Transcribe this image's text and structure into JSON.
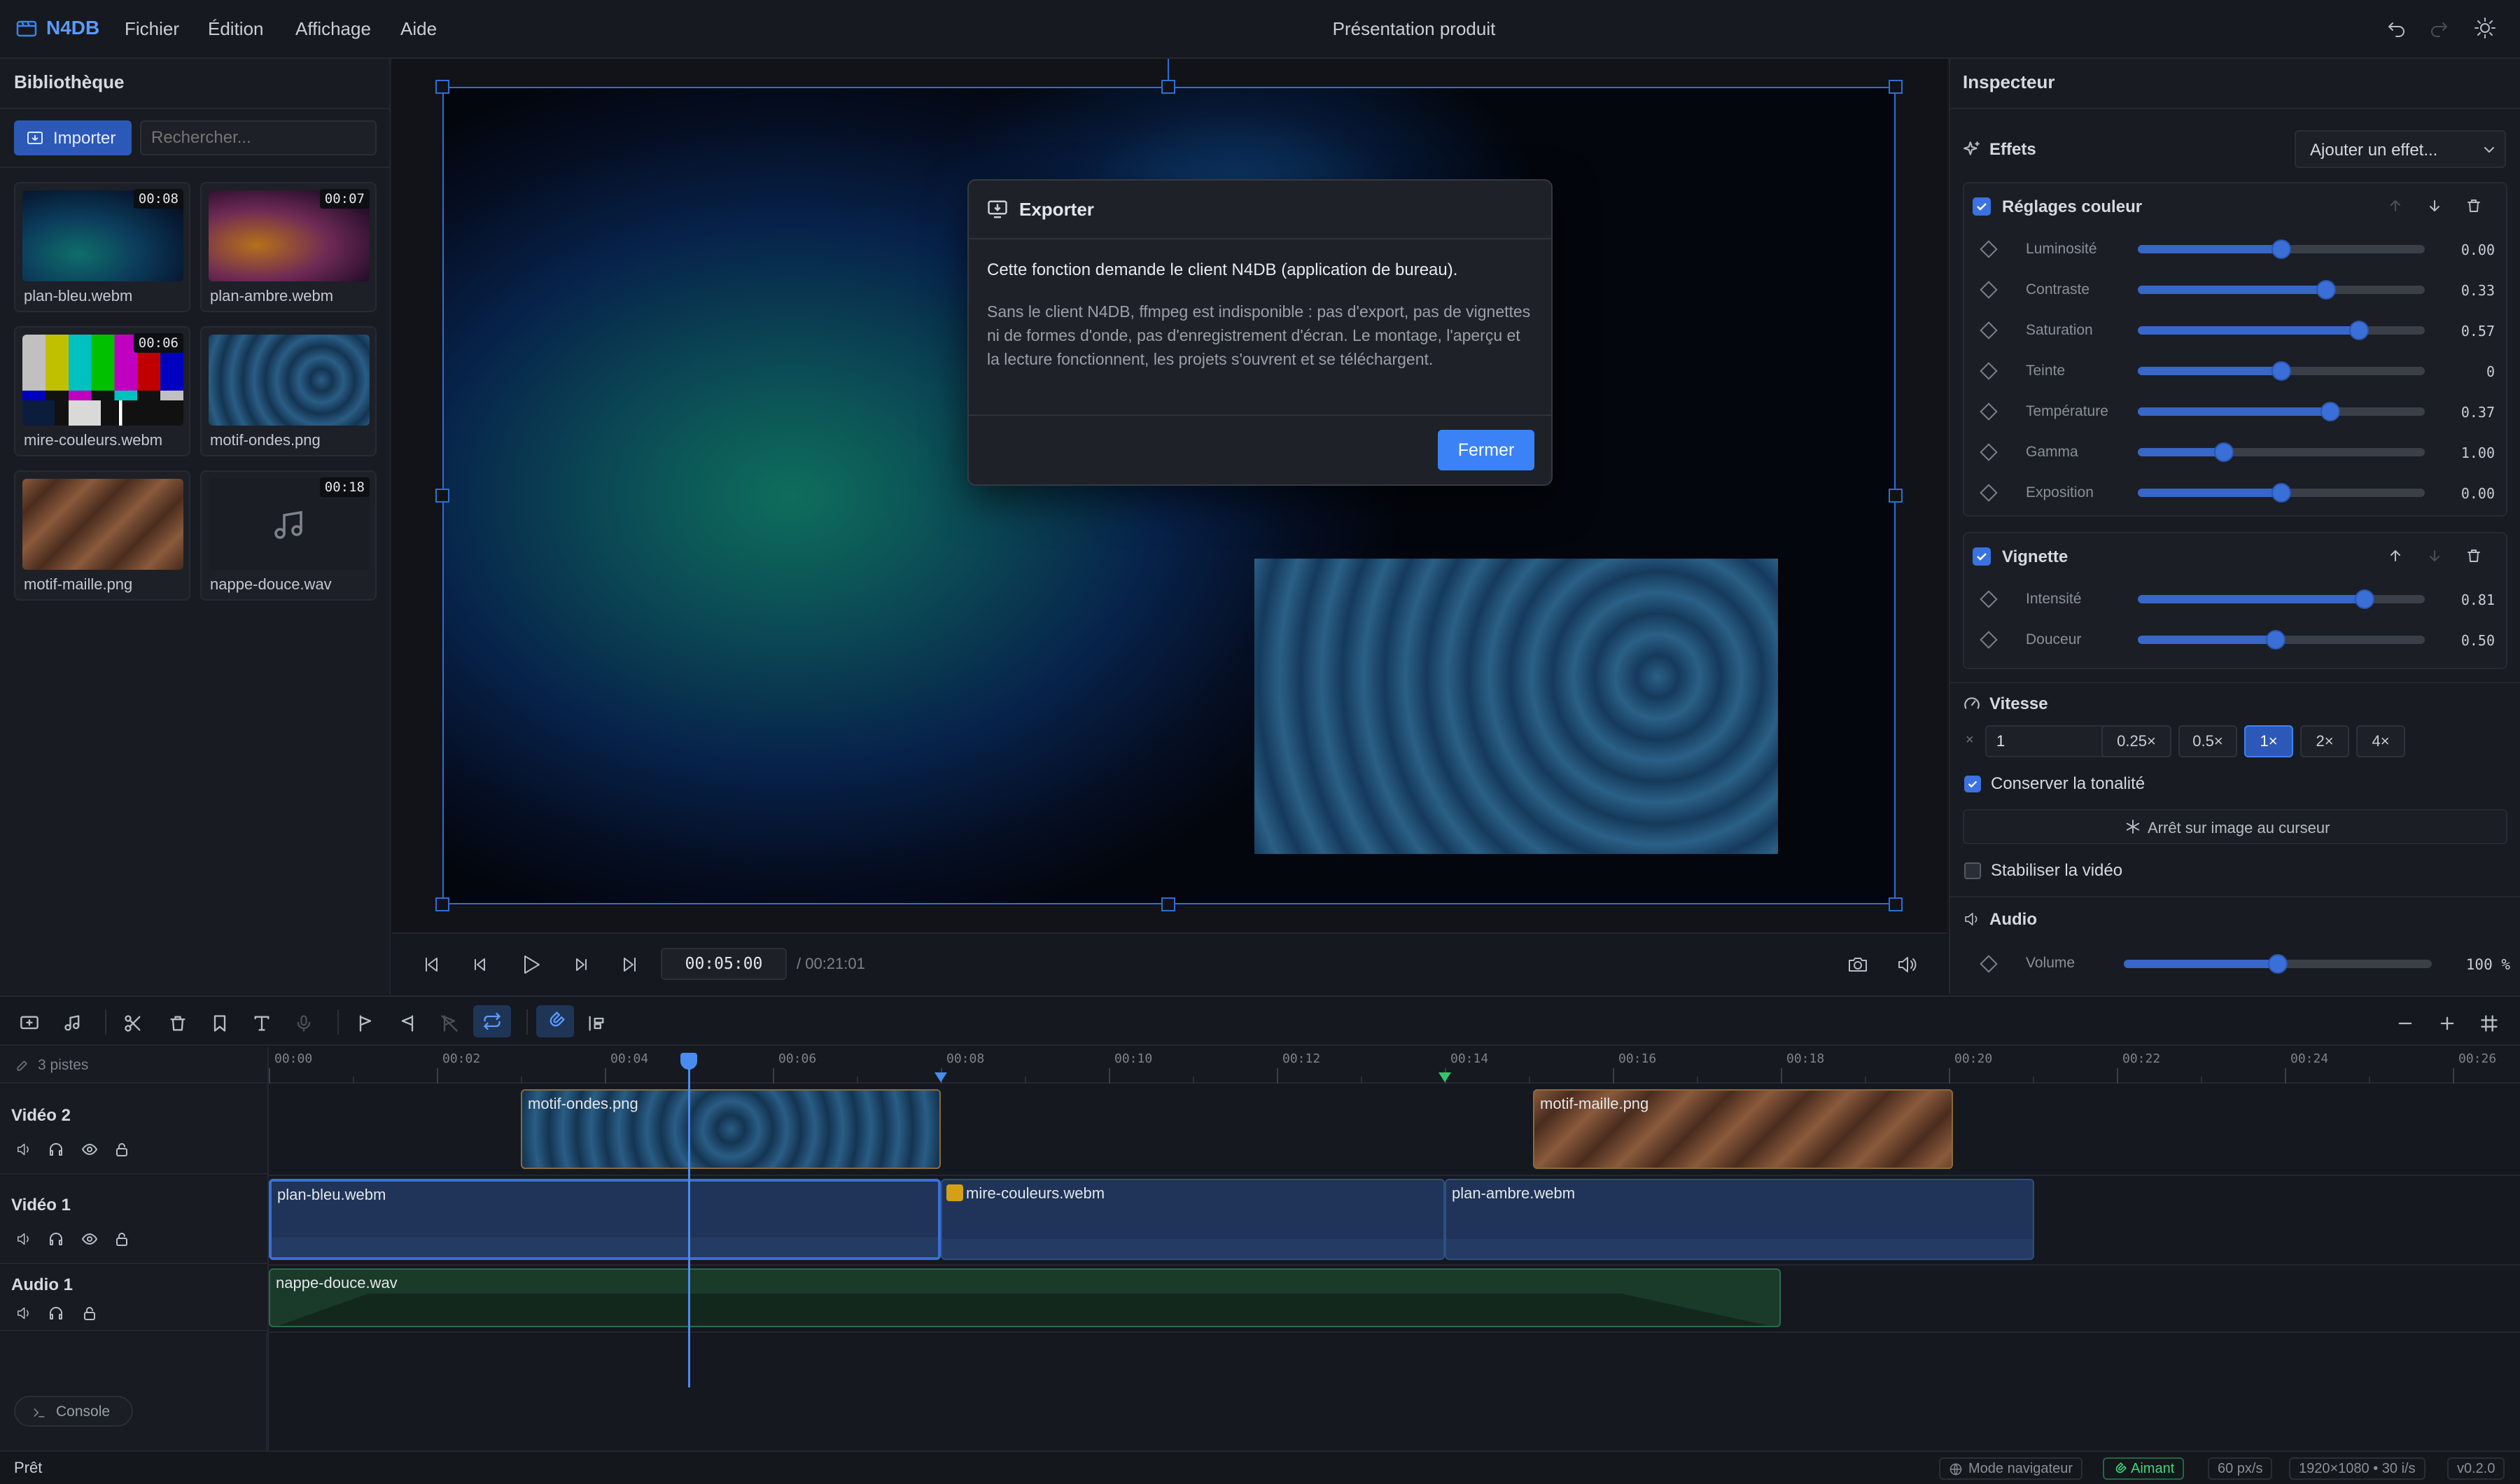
{
  "app": {
    "name": "N4DB",
    "project_title": "Présentation produit"
  },
  "menu": [
    "Fichier",
    "Édition",
    "Affichage",
    "Aide"
  ],
  "library": {
    "title": "Bibliothèque",
    "import_label": "Importer",
    "search_placeholder": "Rechercher...",
    "items": [
      {
        "name": "plan-bleu.webm",
        "duration": "00:08"
      },
      {
        "name": "plan-ambre.webm",
        "duration": "00:07"
      },
      {
        "name": "mire-couleurs.webm",
        "duration": "00:06"
      },
      {
        "name": "motif-ondes.png",
        "duration": ""
      },
      {
        "name": "motif-maille.png",
        "duration": ""
      },
      {
        "name": "nappe-douce.wav",
        "duration": "00:18"
      }
    ]
  },
  "dialog": {
    "title": "Exporter",
    "headline": "Cette fonction demande le client N4DB (application de bureau).",
    "body": "Sans le client N4DB, ffmpeg est indisponible : pas d'export, pas de vignettes ni de formes d'onde, pas d'enregistrement d'écran. Le montage, l'aperçu et la lecture fonctionnent, les projets s'ouvrent et se téléchargent.",
    "close_label": "Fermer"
  },
  "player": {
    "current_time": "00:05:00",
    "total_time": "/ 00:21:01"
  },
  "inspector": {
    "title": "Inspecteur",
    "effects_label": "Effets",
    "add_effect_label": "Ajouter un effet...",
    "color_group": {
      "title": "Réglages couleur",
      "params": [
        {
          "label": "Luminosité",
          "value": "0.00",
          "level": 0.5
        },
        {
          "label": "Contraste",
          "value": "0.33",
          "level": 0.655
        },
        {
          "label": "Saturation",
          "value": "0.57",
          "level": 0.77
        },
        {
          "label": "Teinte",
          "value": "0",
          "level": 0.5
        },
        {
          "label": "Température",
          "value": "0.37",
          "level": 0.67
        },
        {
          "label": "Gamma",
          "value": "1.00",
          "level": 0.3
        },
        {
          "label": "Exposition",
          "value": "0.00",
          "level": 0.5
        }
      ]
    },
    "vignette_group": {
      "title": "Vignette",
      "params": [
        {
          "label": "Intensité",
          "value": "0.81",
          "level": 0.79
        },
        {
          "label": "Douceur",
          "value": "0.50",
          "level": 0.48
        }
      ]
    },
    "speed": {
      "title": "Vitesse",
      "prefix": "×",
      "value": "1",
      "presets": [
        "0.25×",
        "0.5×",
        "1×",
        "2×",
        "4×"
      ],
      "active": "1×",
      "keep_pitch_label": "Conserver la tonalité",
      "freeze_label": "Arrêt sur image au curseur",
      "stabilize_label": "Stabiliser la vidéo"
    },
    "audio": {
      "title": "Audio",
      "volume_label": "Volume",
      "volume_value": "100 %",
      "volume_level": 0.5
    }
  },
  "timeline": {
    "tracks_count": "3 pistes",
    "ruler": [
      "00:00",
      "00:02",
      "00:04",
      "00:06",
      "00:08",
      "00:10",
      "00:12",
      "00:14",
      "00:16",
      "00:18",
      "00:20",
      "00:22",
      "00:24",
      "00:26"
    ],
    "tracks": [
      {
        "name": "Vidéo 2",
        "clips": [
          {
            "name": "motif-ondes.png",
            "start": 3.0,
            "end": 8.0
          },
          {
            "name": "motif-maille.png",
            "start": 15.05,
            "end": 20.05
          }
        ]
      },
      {
        "name": "Vidéo 1",
        "clips": [
          {
            "name": "plan-bleu.webm",
            "start": 0,
            "end": 8.0
          },
          {
            "name": "mire-couleurs.webm",
            "start": 8.0,
            "end": 14.0
          },
          {
            "name": "plan-ambre.webm",
            "start": 14.0,
            "end": 21.02
          }
        ]
      },
      {
        "name": "Audio 1",
        "clips": [
          {
            "name": "nappe-douce.wav",
            "start": 0,
            "end": 18.0
          }
        ]
      }
    ],
    "playhead": 5.0,
    "console_label": "Console"
  },
  "status": {
    "ready": "Prêt",
    "mode": "Mode navigateur",
    "magnet": "Aimant",
    "zoom": "60 px/s",
    "format": "1920×1080 • 30 i/s",
    "version": "v0.2.0"
  },
  "colors": {
    "accent": "#3b82f6",
    "magnet": "#22c55e"
  }
}
